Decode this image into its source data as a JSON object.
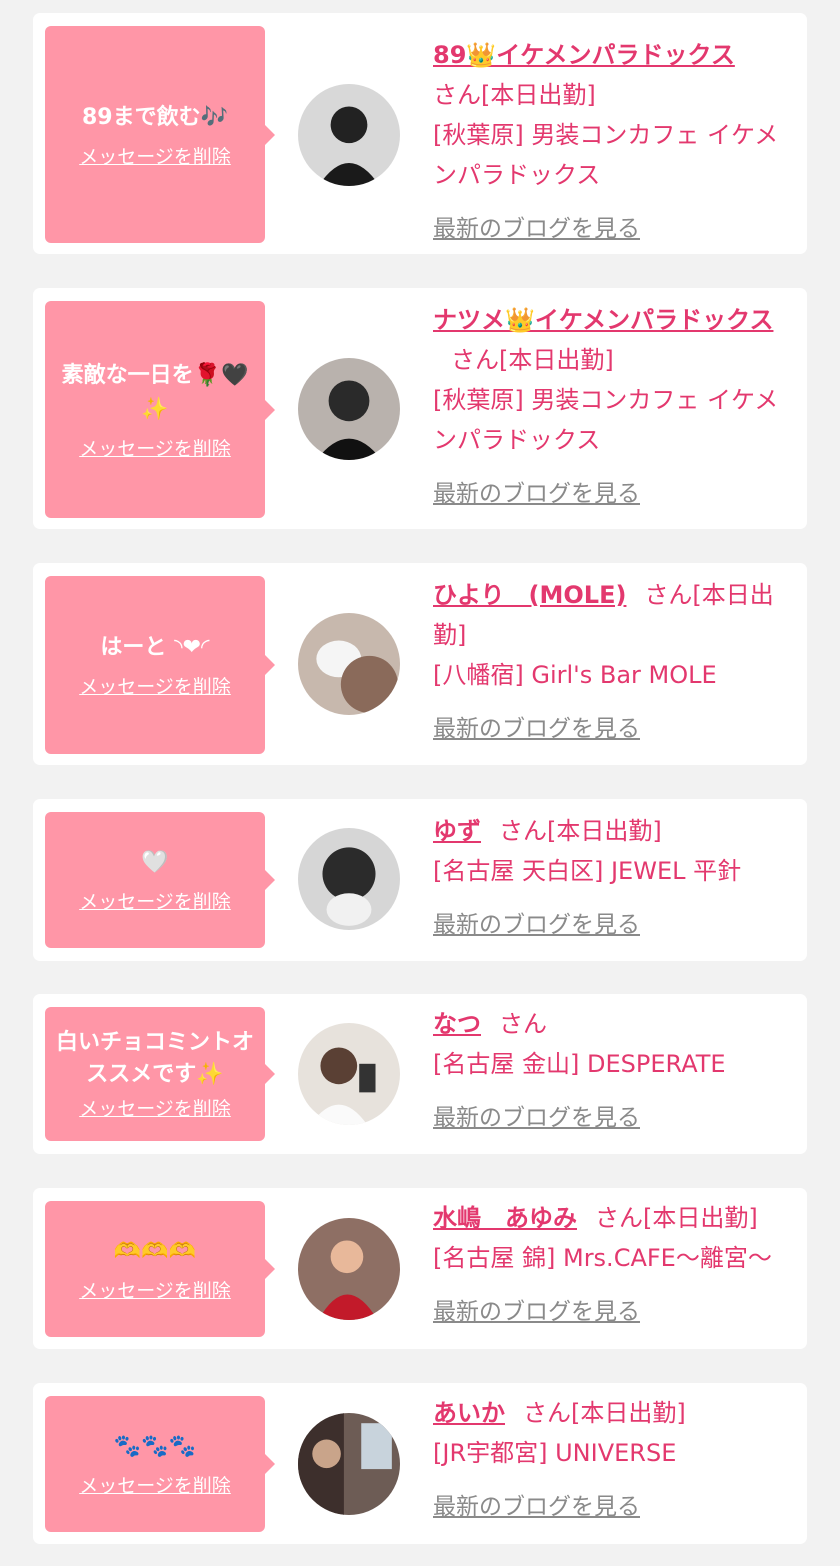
{
  "delete_label": "メッセージを削除",
  "blog_label": "最新のブログを見る",
  "colors": {
    "background": "#f2f2f2",
    "card": "#ffffff",
    "bubble": "#ff96a7",
    "accent": "#e3386e",
    "blog_link": "#8a8a8a"
  },
  "messages": [
    {
      "message": "89まで飲む🎶",
      "name": "89👑イケメンパラドックス",
      "suffix": "さん[本日出勤]",
      "shop": "[秋葉原] 男装コンカフェ イケメンパラドックス",
      "avatar": "avatar-photo"
    },
    {
      "message": "素敵な一日を🌹🖤✨",
      "name": "ナツメ👑イケメンパラドックス",
      "suffix": "さん[本日出勤]",
      "shop": "[秋葉原] 男装コンカフェ イケメンパラドックス",
      "avatar": "avatar-photo"
    },
    {
      "message": "はーと ◝❤︎◜",
      "name": "ひより　(MOLE)",
      "suffix": "さん[本日出勤]",
      "shop": "[八幡宿] Girl's Bar MOLE",
      "avatar": "avatar-photo"
    },
    {
      "message": "🤍",
      "name": "ゆず",
      "suffix": "さん[本日出勤]",
      "shop": "[名古屋 天白区] JEWEL 平針",
      "avatar": "avatar-photo"
    },
    {
      "message": "白いチョコミントオススメです✨",
      "name": "なつ",
      "suffix": "さん",
      "shop": "[名古屋 金山] DESPERATE",
      "avatar": "avatar-photo"
    },
    {
      "message": "🫶🫶🫶",
      "name": "水嶋　あゆみ",
      "suffix": "さん[本日出勤]",
      "shop": "[名古屋 錦] Mrs.CAFE～離宮～",
      "avatar": "avatar-photo"
    },
    {
      "message": "🐾🐾🐾",
      "name": "あいか",
      "suffix": "さん[本日出勤]",
      "shop": "[JR宇都宮] UNIVERSE",
      "avatar": "avatar-photo"
    }
  ]
}
